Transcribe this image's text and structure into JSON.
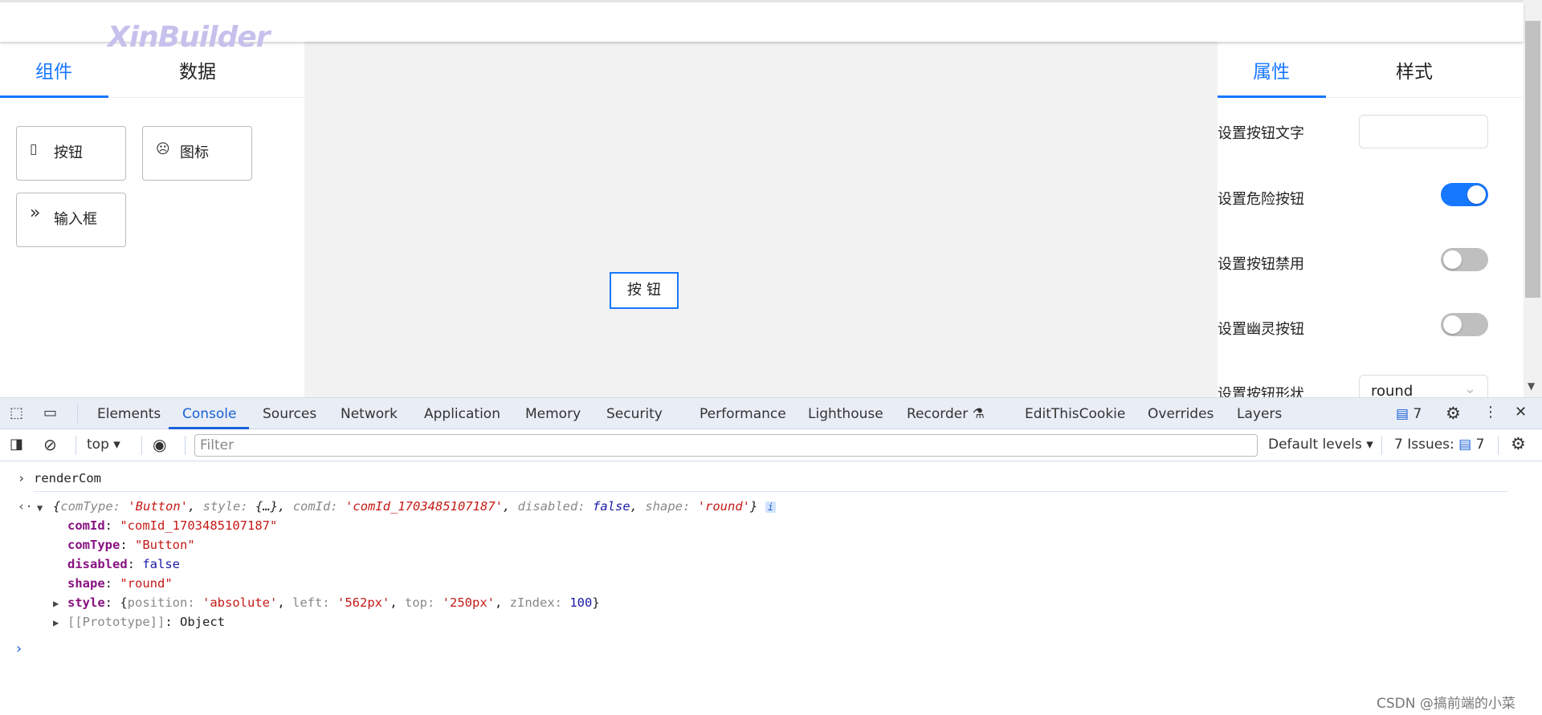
{
  "app": {
    "logo": "XinBuilder"
  },
  "left_panel": {
    "tabs": [
      {
        "label": "组件",
        "active": true
      },
      {
        "label": "数据",
        "active": false
      }
    ],
    "components": [
      {
        "icon": "mobile-icon",
        "glyph": "▯",
        "label": "按钮"
      },
      {
        "icon": "frown-icon",
        "glyph": "☹",
        "label": "图标"
      },
      {
        "icon": "double-right-icon",
        "glyph": "»",
        "label": "输入框"
      }
    ]
  },
  "canvas": {
    "button_label": "按钮"
  },
  "right_panel": {
    "tabs": [
      {
        "label": "属性",
        "active": true
      },
      {
        "label": "样式",
        "active": false
      }
    ],
    "props": [
      {
        "label": "设置按钮文字",
        "type": "input",
        "value": ""
      },
      {
        "label": "设置危险按钮",
        "type": "switch",
        "checked": true
      },
      {
        "label": "设置按钮禁用",
        "type": "switch",
        "checked": false
      },
      {
        "label": "设置幽灵按钮",
        "type": "switch",
        "checked": false
      },
      {
        "label": "设置按钮形状",
        "type": "select",
        "value": "round"
      }
    ]
  },
  "devtools": {
    "tabs": [
      "Elements",
      "Console",
      "Sources",
      "Network",
      "Application",
      "Memory",
      "Security",
      "Performance",
      "Lighthouse",
      "Recorder",
      "EditThisCookie",
      "Overrides",
      "Layers"
    ],
    "active_tab": "Console",
    "issues_badge": "7",
    "toolbar": {
      "context": "top",
      "filter_placeholder": "Filter",
      "levels": "Default levels",
      "issues_label": "7 Issues:",
      "issues_count": "7"
    },
    "console": {
      "input": "renderCom",
      "summary": {
        "open": "{",
        "p1": "comType",
        "v1": "'Button'",
        "p2": "style",
        "v2": "{…}",
        "p3": "comId",
        "v3": "'comId_1703485107187'",
        "p4": "disabled",
        "v4": "false",
        "p5": "shape",
        "v5": "'round'",
        "close": "}"
      },
      "props": [
        {
          "key": "comId",
          "value": "\"comId_1703485107187\""
        },
        {
          "key": "comType",
          "value": "\"Button\""
        },
        {
          "key": "disabled",
          "value": "false"
        },
        {
          "key": "shape",
          "value": "\"round\""
        }
      ],
      "style": {
        "key": "style",
        "position": "'absolute'",
        "left": "'562px'",
        "top": "'250px'",
        "zIndex": "100"
      },
      "prototype": {
        "key": "[[Prototype]]",
        "value": "Object"
      }
    }
  },
  "watermark": "CSDN @搞前端的小菜"
}
